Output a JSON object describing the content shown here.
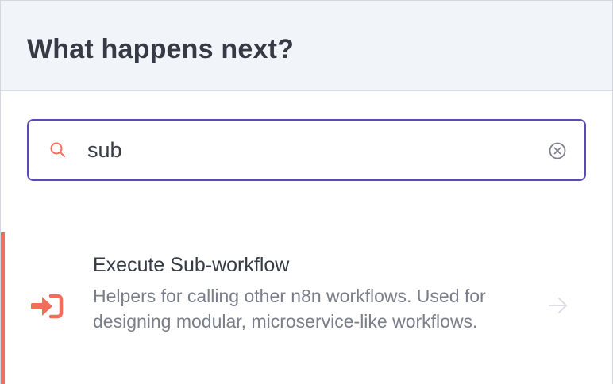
{
  "header": {
    "title": "What happens next?"
  },
  "search": {
    "value": "sub",
    "icon": "search-icon",
    "clear_icon": "clear-circle-x-icon"
  },
  "results": [
    {
      "title": "Execute Sub-workflow",
      "description": "Helpers for calling other n8n workflows. Used for designing modular, microservice-like workflows.",
      "icon": "sign-in-arrow-icon",
      "action_icon": "arrow-right-icon",
      "selected": true
    }
  ],
  "colors": {
    "accent": "#f36d5d",
    "focus_border": "#5b4ab5",
    "header_bg": "#f1f4f9",
    "title_text": "#363a44",
    "muted_text": "#7a7e89"
  }
}
